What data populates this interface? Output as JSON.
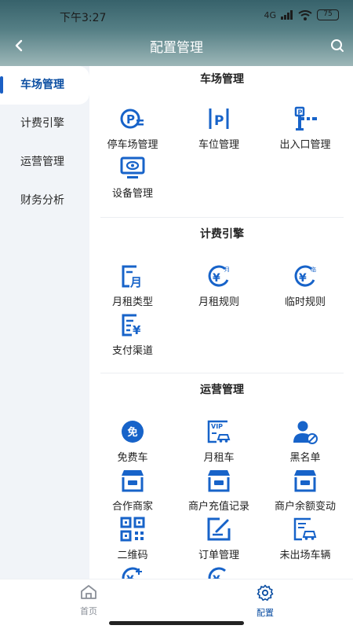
{
  "status_bar": {
    "time": "下午3:27",
    "battery": "75",
    "network": "4G"
  },
  "nav": {
    "title": "配置管理"
  },
  "sidebar": {
    "items": [
      {
        "label": "车场管理",
        "active": true
      },
      {
        "label": "计费引擎",
        "active": false
      },
      {
        "label": "运营管理",
        "active": false
      },
      {
        "label": "财务分析",
        "active": false
      }
    ]
  },
  "sections": [
    {
      "title": "车场管理",
      "items": [
        {
          "label": "停车场管理",
          "icon": "parking-lot-icon"
        },
        {
          "label": "车位管理",
          "icon": "parking-space-icon"
        },
        {
          "label": "出入口管理",
          "icon": "gate-barrier-icon"
        },
        {
          "label": "设备管理",
          "icon": "device-monitor-icon"
        }
      ]
    },
    {
      "title": "计费引擎",
      "items": [
        {
          "label": "月租类型",
          "icon": "monthly-type-icon"
        },
        {
          "label": "月租规则",
          "icon": "monthly-rule-icon"
        },
        {
          "label": "临时规则",
          "icon": "temporary-rule-icon"
        },
        {
          "label": "支付渠道",
          "icon": "payment-channel-icon"
        }
      ]
    },
    {
      "title": "运营管理",
      "items": [
        {
          "label": "免费车",
          "icon": "free-car-icon",
          "badge": "免"
        },
        {
          "label": "月租车",
          "icon": "vip-car-icon",
          "badge": "VIP"
        },
        {
          "label": "黑名单",
          "icon": "blacklist-icon"
        },
        {
          "label": "合作商家",
          "icon": "merchant-store-icon"
        },
        {
          "label": "商户充值记录",
          "icon": "merchant-recharge-icon"
        },
        {
          "label": "商户余额变动",
          "icon": "merchant-balance-icon"
        },
        {
          "label": "二维码",
          "icon": "qr-code-icon"
        },
        {
          "label": "订单管理",
          "icon": "order-edit-icon"
        },
        {
          "label": "未出场车辆",
          "icon": "parked-vehicle-icon"
        },
        {
          "label": "",
          "icon": "coin-add-icon"
        },
        {
          "label": "",
          "icon": "coin-rule-icon"
        }
      ]
    }
  ],
  "tabbar": {
    "items": [
      {
        "label": "首页",
        "icon": "home-icon",
        "active": false
      },
      {
        "label": "配置",
        "icon": "settings-gear-icon",
        "active": true
      }
    ]
  },
  "colors": {
    "primary": "#0b4ea2",
    "icon_blue": "#1763c9",
    "header_dark": "#37626b",
    "sidebar_bg": "#f1f4f8"
  }
}
